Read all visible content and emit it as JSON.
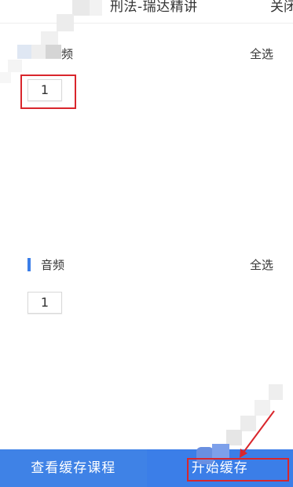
{
  "header": {
    "title": "刑法-瑞达精讲",
    "close_label": "关闭"
  },
  "video_section": {
    "label": "频",
    "select_all": "全选",
    "items": [
      "1"
    ]
  },
  "audio_section": {
    "label": "音频",
    "select_all": "全选",
    "items": [
      "1"
    ]
  },
  "bottom": {
    "view_cached_label": "查看缓存课程",
    "start_cache_label": "开始缓存"
  },
  "colors": {
    "accent": "#3b7ee8",
    "annotation_red": "#d9262c"
  }
}
